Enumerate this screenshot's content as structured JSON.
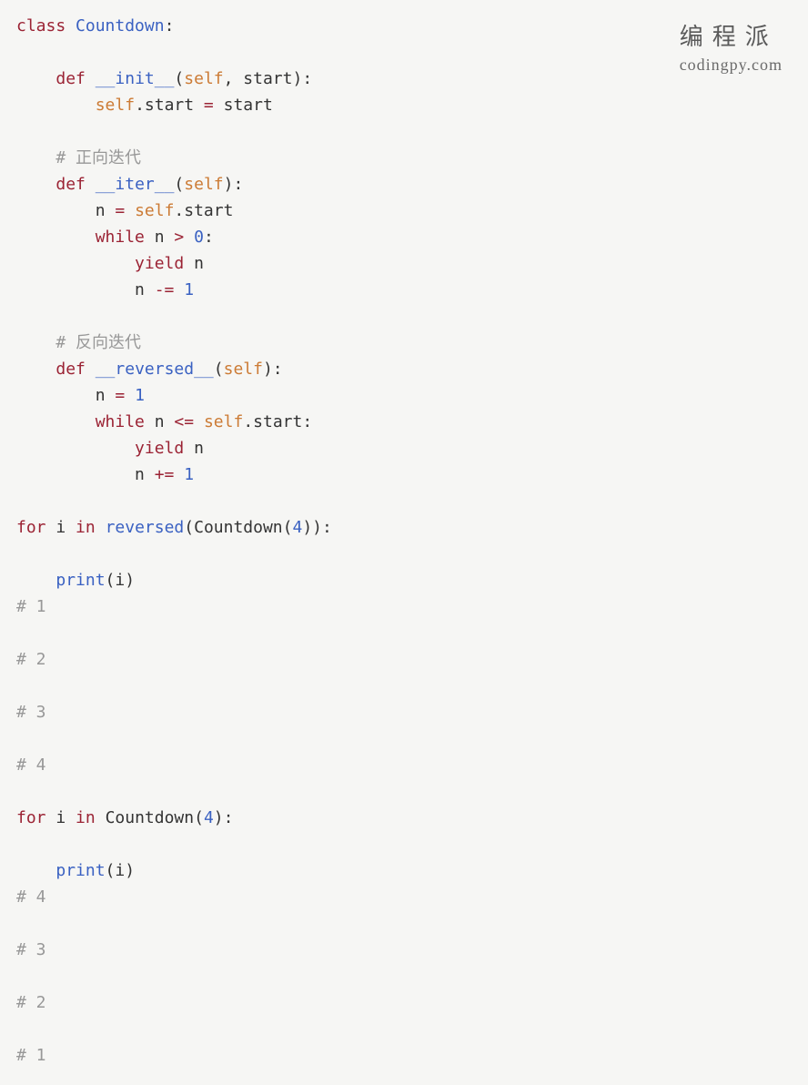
{
  "watermark": {
    "cn": "编程派",
    "en": "codingpy.com"
  },
  "code": {
    "tokens": [
      [
        [
          "class ",
          "kw"
        ],
        [
          "Countdown",
          "cls"
        ],
        [
          ":",
          "pn"
        ]
      ],
      [],
      [
        [
          "    ",
          "pn"
        ],
        [
          "def ",
          "kw"
        ],
        [
          "__init__",
          "fn"
        ],
        [
          "(",
          "pn"
        ],
        [
          "self",
          "self"
        ],
        [
          ", start):",
          "pn"
        ]
      ],
      [
        [
          "        ",
          "pn"
        ],
        [
          "self",
          "self"
        ],
        [
          ".start ",
          "pn"
        ],
        [
          "=",
          "op"
        ],
        [
          " start",
          "pn"
        ]
      ],
      [],
      [
        [
          "    ",
          "pn"
        ],
        [
          "# 正向迭代",
          "cmt"
        ]
      ],
      [
        [
          "    ",
          "pn"
        ],
        [
          "def ",
          "kw"
        ],
        [
          "__iter__",
          "fn"
        ],
        [
          "(",
          "pn"
        ],
        [
          "self",
          "self"
        ],
        [
          "):",
          "pn"
        ]
      ],
      [
        [
          "        n ",
          "pn"
        ],
        [
          "=",
          "op"
        ],
        [
          " ",
          "pn"
        ],
        [
          "self",
          "self"
        ],
        [
          ".start",
          "pn"
        ]
      ],
      [
        [
          "        ",
          "pn"
        ],
        [
          "while ",
          "kw"
        ],
        [
          "n ",
          "pn"
        ],
        [
          ">",
          "op"
        ],
        [
          " ",
          "pn"
        ],
        [
          "0",
          "num"
        ],
        [
          ":",
          "pn"
        ]
      ],
      [
        [
          "            ",
          "pn"
        ],
        [
          "yield ",
          "kw"
        ],
        [
          "n",
          "pn"
        ]
      ],
      [
        [
          "            n ",
          "pn"
        ],
        [
          "-=",
          "op"
        ],
        [
          " ",
          "pn"
        ],
        [
          "1",
          "num"
        ]
      ],
      [],
      [
        [
          "    ",
          "pn"
        ],
        [
          "# 反向迭代",
          "cmt"
        ]
      ],
      [
        [
          "    ",
          "pn"
        ],
        [
          "def ",
          "kw"
        ],
        [
          "__reversed__",
          "fn"
        ],
        [
          "(",
          "pn"
        ],
        [
          "self",
          "self"
        ],
        [
          "):",
          "pn"
        ]
      ],
      [
        [
          "        n ",
          "pn"
        ],
        [
          "=",
          "op"
        ],
        [
          " ",
          "pn"
        ],
        [
          "1",
          "num"
        ]
      ],
      [
        [
          "        ",
          "pn"
        ],
        [
          "while ",
          "kw"
        ],
        [
          "n ",
          "pn"
        ],
        [
          "<=",
          "op"
        ],
        [
          " ",
          "pn"
        ],
        [
          "self",
          "self"
        ],
        [
          ".start:",
          "pn"
        ]
      ],
      [
        [
          "            ",
          "pn"
        ],
        [
          "yield ",
          "kw"
        ],
        [
          "n",
          "pn"
        ]
      ],
      [
        [
          "            n ",
          "pn"
        ],
        [
          "+=",
          "op"
        ],
        [
          " ",
          "pn"
        ],
        [
          "1",
          "num"
        ]
      ],
      [],
      [
        [
          "for ",
          "kw"
        ],
        [
          "i ",
          "pn"
        ],
        [
          "in ",
          "kw"
        ],
        [
          "reversed",
          "call"
        ],
        [
          "(Countdown(",
          "pn"
        ],
        [
          "4",
          "num"
        ],
        [
          ")):",
          "pn"
        ]
      ],
      [],
      [
        [
          "    ",
          "pn"
        ],
        [
          "print",
          "call"
        ],
        [
          "(i)",
          "pn"
        ]
      ],
      [
        [
          "# 1",
          "cmt"
        ]
      ],
      [],
      [
        [
          "# 2",
          "cmt"
        ]
      ],
      [],
      [
        [
          "# 3",
          "cmt"
        ]
      ],
      [],
      [
        [
          "# 4",
          "cmt"
        ]
      ],
      [],
      [
        [
          "for ",
          "kw"
        ],
        [
          "i ",
          "pn"
        ],
        [
          "in ",
          "kw"
        ],
        [
          "Countdown(",
          "pn"
        ],
        [
          "4",
          "num"
        ],
        [
          "):",
          "pn"
        ]
      ],
      [],
      [
        [
          "    ",
          "pn"
        ],
        [
          "print",
          "call"
        ],
        [
          "(i)",
          "pn"
        ]
      ],
      [
        [
          "# 4",
          "cmt"
        ]
      ],
      [],
      [
        [
          "# 3",
          "cmt"
        ]
      ],
      [],
      [
        [
          "# 2",
          "cmt"
        ]
      ],
      [],
      [
        [
          "# 1",
          "cmt"
        ]
      ]
    ]
  }
}
